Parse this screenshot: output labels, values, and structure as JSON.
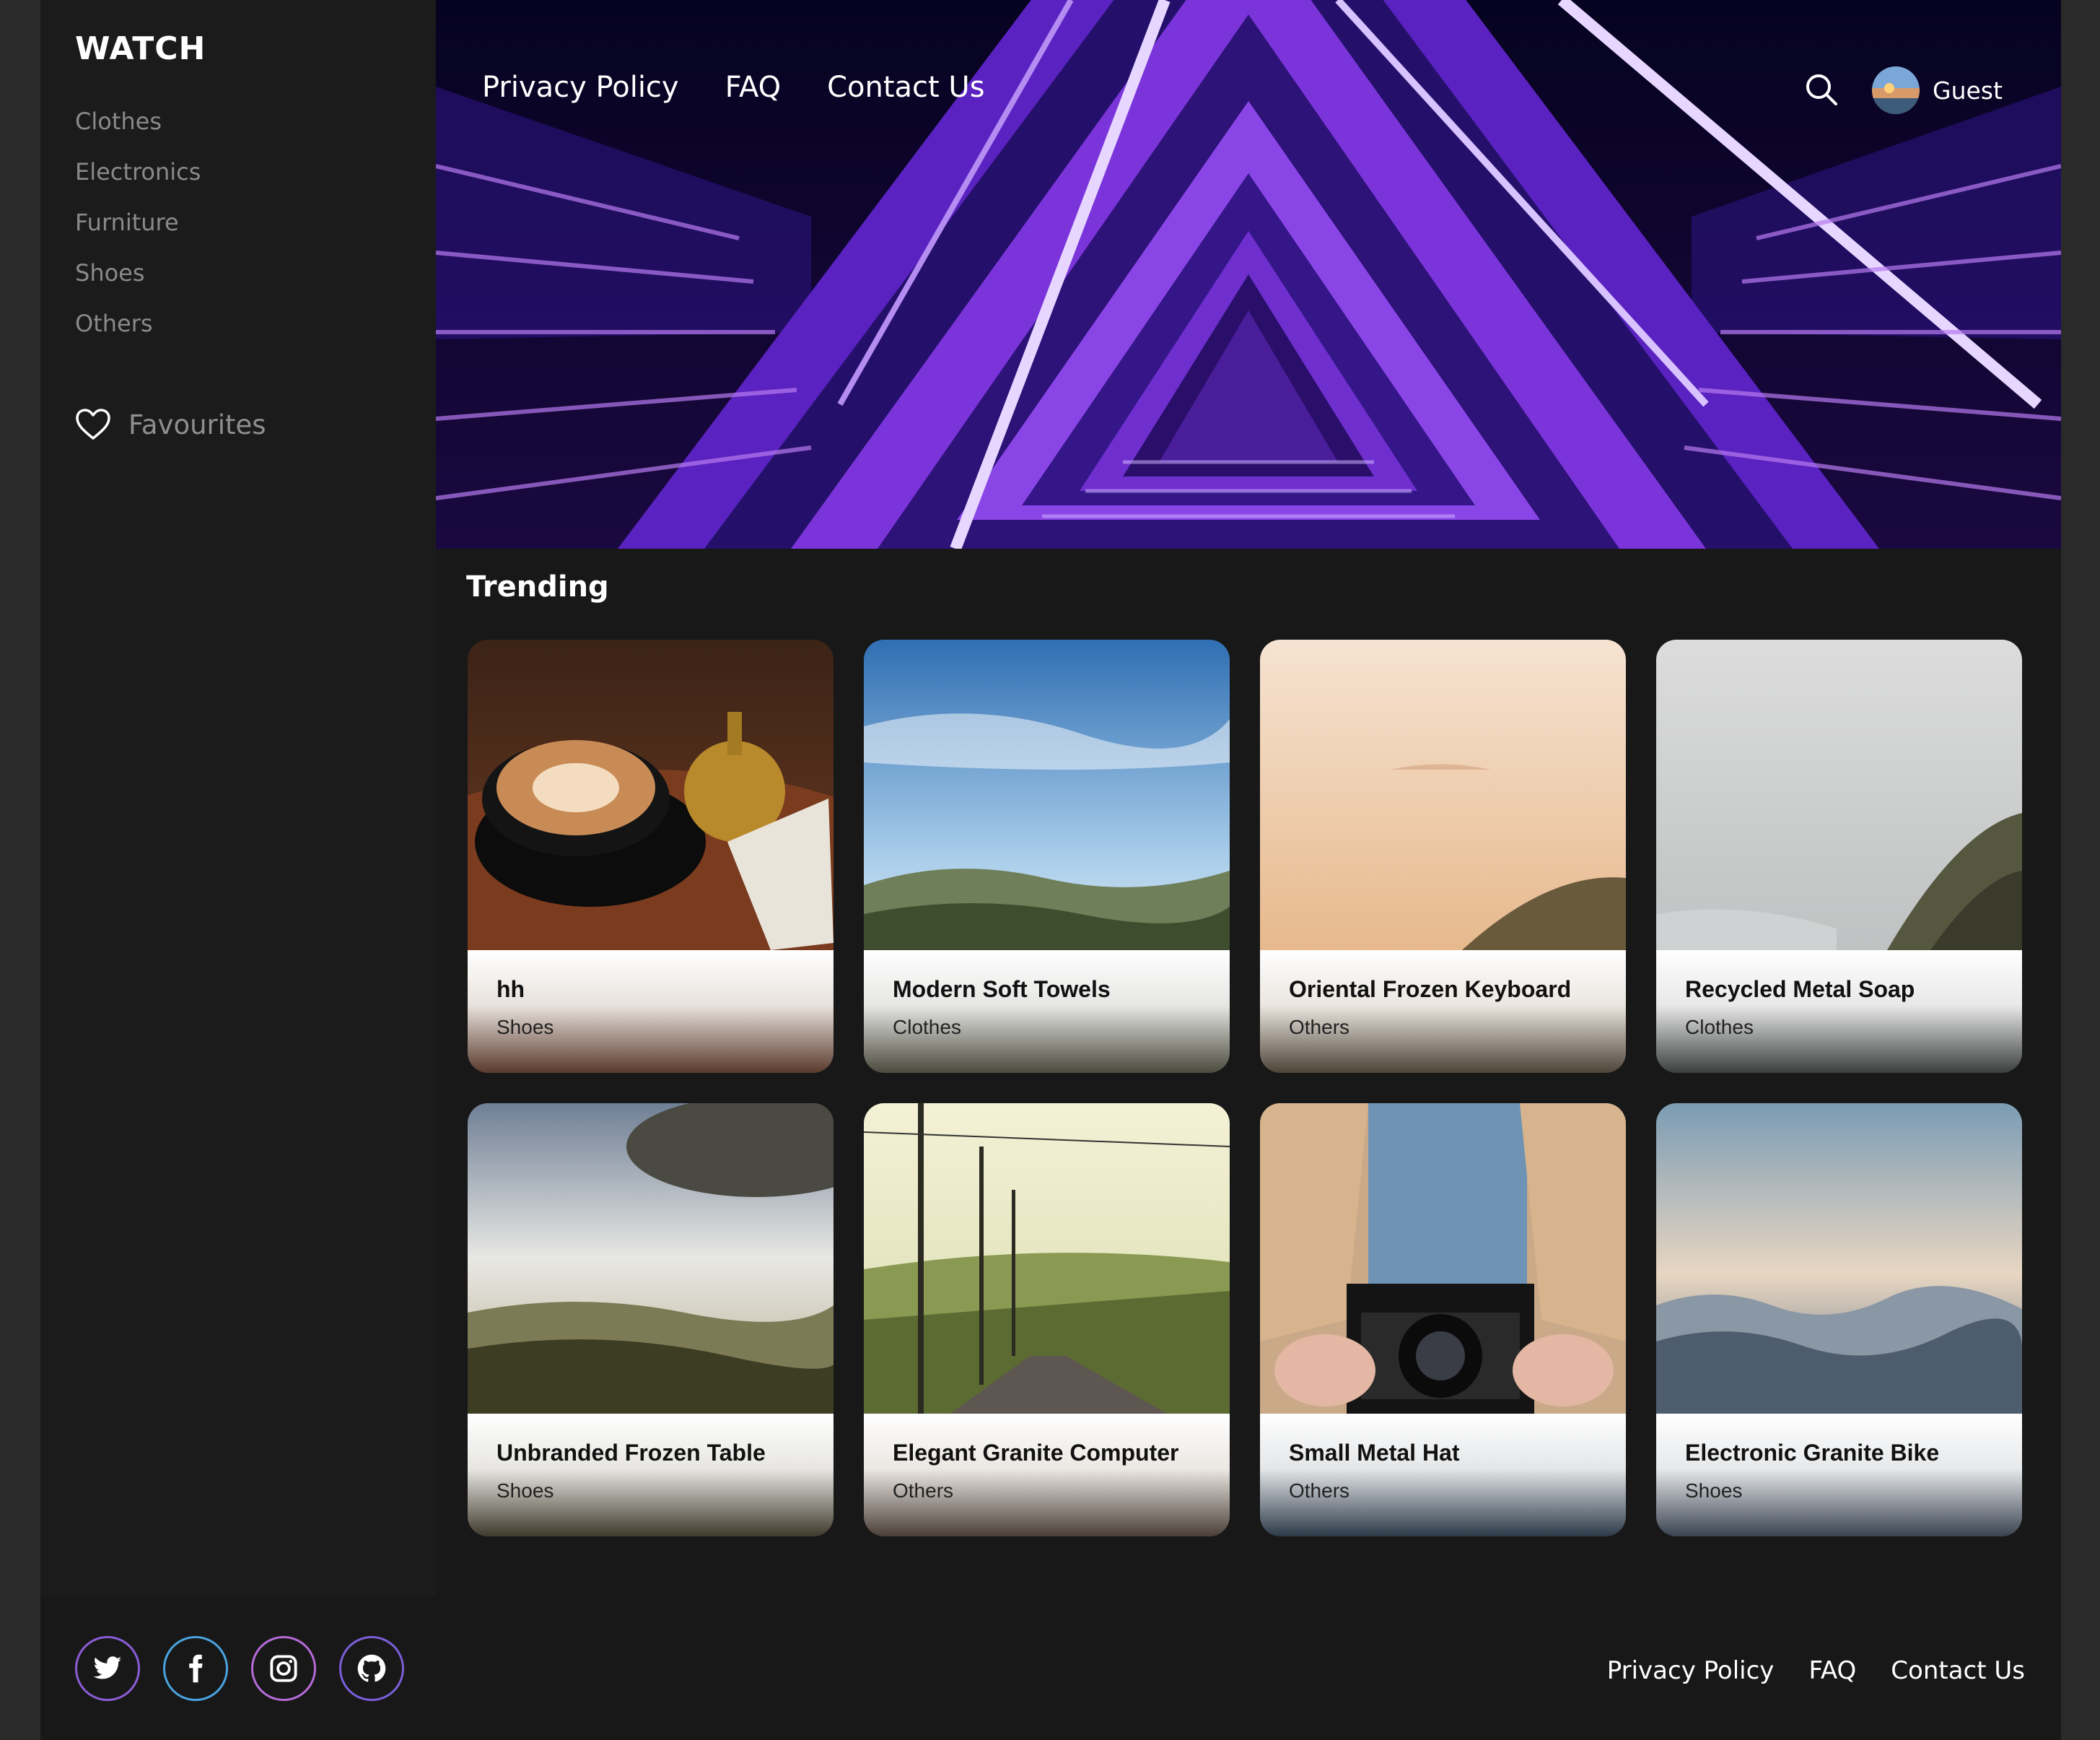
{
  "sidebar": {
    "brand": "WATCH",
    "categories": [
      "Clothes",
      "Electronics",
      "Furniture",
      "Shoes",
      "Others"
    ],
    "favourites_label": "Favourites"
  },
  "header": {
    "nav": [
      "Privacy Policy",
      "FAQ",
      "Contact Us"
    ],
    "search_icon": "search-icon",
    "user_name": "Guest"
  },
  "trending": {
    "title": "Trending",
    "cards": [
      {
        "name": "hh",
        "category": "Shoes"
      },
      {
        "name": "Modern Soft Towels",
        "category": "Clothes"
      },
      {
        "name": "Oriental Frozen Keyboard",
        "category": "Others"
      },
      {
        "name": "Recycled Metal Soap",
        "category": "Clothes"
      },
      {
        "name": "Unbranded Frozen Table",
        "category": "Shoes"
      },
      {
        "name": "Elegant Granite Computer",
        "category": "Others"
      },
      {
        "name": "Small Metal Hat",
        "category": "Others"
      },
      {
        "name": "Electronic Granite Bike",
        "category": "Shoes"
      }
    ]
  },
  "footer": {
    "socials": [
      "twitter-icon",
      "facebook-icon",
      "instagram-icon",
      "github-icon"
    ],
    "links": [
      "Privacy Policy",
      "FAQ",
      "Contact Us"
    ]
  },
  "colors": {
    "background": "#181818",
    "sidebar": "#1b1b1b",
    "hero_purple": "#7b2cd6",
    "muted_text": "#8a8a8a"
  }
}
